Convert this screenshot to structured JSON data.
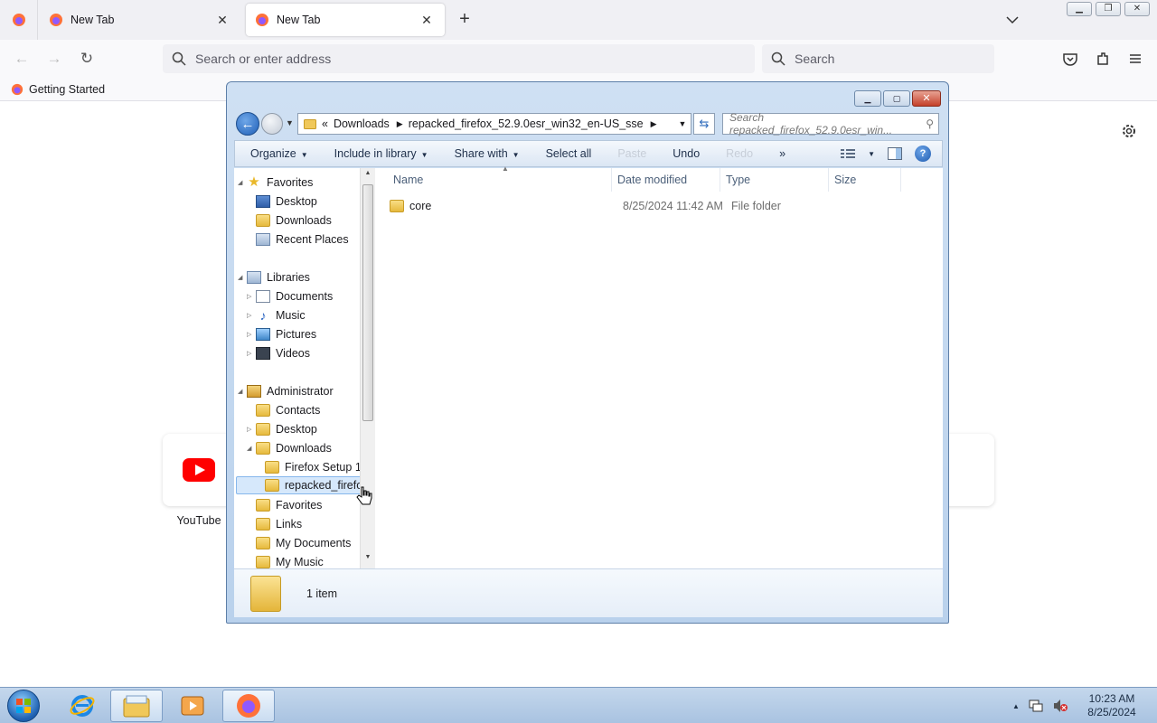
{
  "browser": {
    "tabs": [
      {
        "label": "New Tab",
        "active": false
      },
      {
        "label": "New Tab",
        "active": true
      }
    ],
    "url_placeholder": "Search or enter address",
    "search_placeholder": "Search",
    "bookmark": "Getting Started",
    "shortcut_label": "YouTube"
  },
  "explorer": {
    "breadcrumb_prefix": "«",
    "breadcrumb": [
      "Downloads",
      "repacked_firefox_52.9.0esr_win32_en-US_sse"
    ],
    "search_placeholder": "Search repacked_firefox_52.9.0esr_win...",
    "toolbar": {
      "organize": "Organize",
      "include_in_library": "Include in library",
      "share_with": "Share with",
      "select_all": "Select all",
      "paste": "Paste",
      "undo": "Undo",
      "redo": "Redo",
      "more": "»"
    },
    "nav_tree": [
      {
        "label": "Favorites",
        "icon": "star-icon"
      },
      {
        "label": "Desktop",
        "icon": "desktop-icon"
      },
      {
        "label": "Downloads",
        "icon": "folder-icon"
      },
      {
        "label": "Recent Places",
        "icon": "recent-places-icon"
      },
      {
        "label": "Libraries",
        "icon": "libraries-icon"
      },
      {
        "label": "Documents",
        "icon": "documents-icon"
      },
      {
        "label": "Music",
        "icon": "music-icon"
      },
      {
        "label": "Pictures",
        "icon": "pictures-icon"
      },
      {
        "label": "Videos",
        "icon": "videos-icon"
      },
      {
        "label": "Administrator",
        "icon": "user-folder-icon"
      },
      {
        "label": "Contacts",
        "icon": "folder-icon"
      },
      {
        "label": "Desktop",
        "icon": "folder-icon"
      },
      {
        "label": "Downloads",
        "icon": "folder-icon"
      },
      {
        "label": "Firefox Setup 1:",
        "icon": "folder-icon"
      },
      {
        "label": "repacked_firefo",
        "icon": "folder-icon",
        "selected": true
      },
      {
        "label": "Favorites",
        "icon": "folder-icon"
      },
      {
        "label": "Links",
        "icon": "folder-icon"
      },
      {
        "label": "My Documents",
        "icon": "folder-icon"
      },
      {
        "label": "My Music",
        "icon": "folder-icon"
      }
    ],
    "columns": [
      "Name",
      "Date modified",
      "Type",
      "Size"
    ],
    "files": [
      {
        "name": "core",
        "date": "8/25/2024 11:42 AM",
        "type": "File folder",
        "size": ""
      }
    ],
    "status": "1 item"
  },
  "taskbar": {
    "time": "10:23 AM",
    "date": "8/25/2024"
  },
  "colors": {
    "selection": "#d6e8fb",
    "taskbar": "#b7cde7",
    "youtube_red": "#ff0000"
  }
}
